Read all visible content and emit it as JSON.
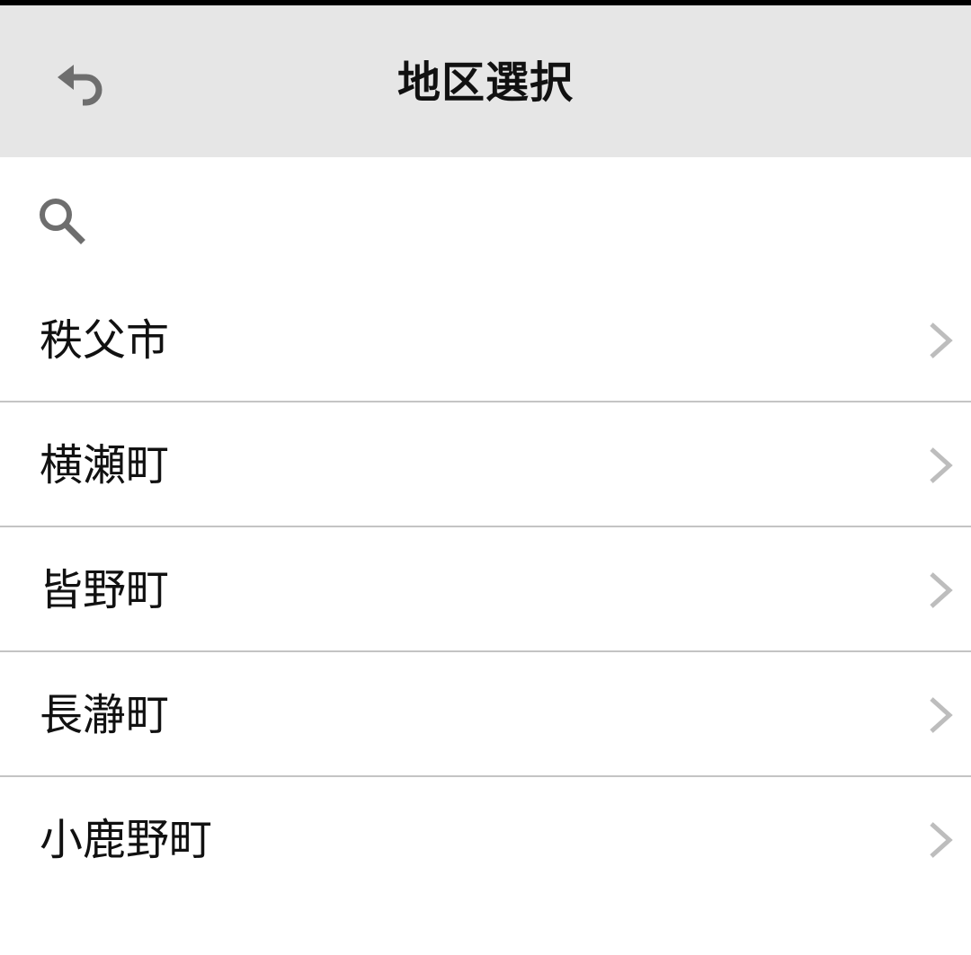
{
  "header": {
    "title": "地区選択",
    "back_icon": "undo-icon"
  },
  "search": {
    "icon": "search-icon",
    "value": "",
    "placeholder": ""
  },
  "areas": [
    {
      "label": "秩父市"
    },
    {
      "label": "横瀬町"
    },
    {
      "label": "皆野町"
    },
    {
      "label": "長瀞町"
    },
    {
      "label": "小鹿野町"
    }
  ],
  "colors": {
    "header_bg": "#e6e6e6",
    "divider": "#c4c4c4",
    "icon": "#6e6e6e",
    "chevron": "#bdbdbd",
    "text": "#111111"
  }
}
